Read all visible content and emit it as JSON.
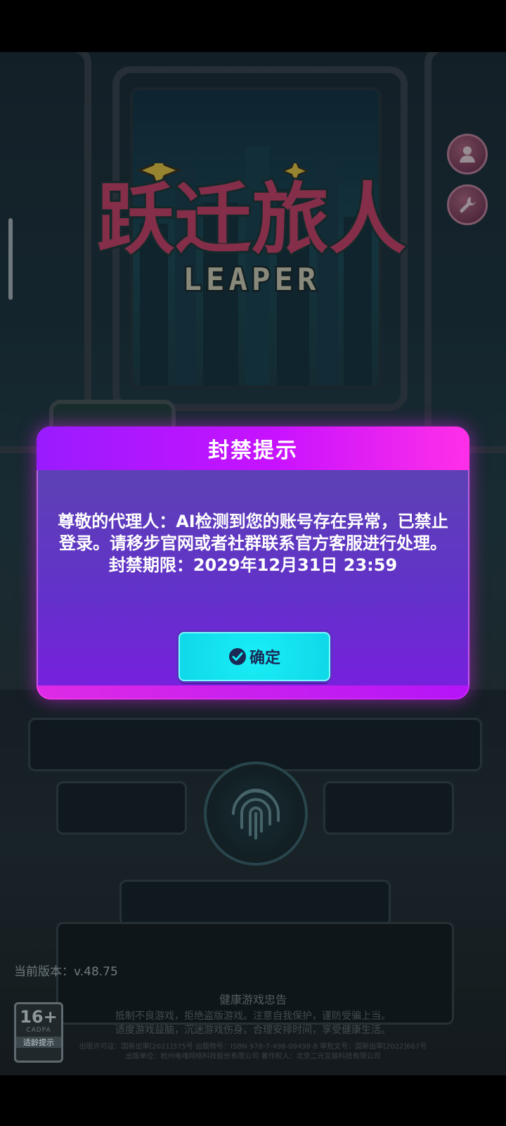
{
  "game": {
    "logo_text": "跃迁旅人",
    "logo_subtitle": "LEAPER"
  },
  "side_buttons": [
    {
      "icon": "user-icon"
    },
    {
      "icon": "wrench-icon"
    }
  ],
  "dialog": {
    "title": "封禁提示",
    "message": "尊敬的代理人：AI检测到您的账号存在异常，已禁止登录。请移步官网或者社群联系官方客服进行处理。",
    "deadline_label": "封禁期限：",
    "deadline_value": "2029年12月31日 23:59",
    "confirm_label": "确定",
    "colors": {
      "header": "#c812ff",
      "body": "#6232c9",
      "button": "#19eef6"
    }
  },
  "footer": {
    "version": "当前版本：v.48.75",
    "age_rating": "16+",
    "age_brand": "CADPA",
    "age_label": "适龄提示",
    "health_title": "健康游戏忠告",
    "health_line_1": "抵制不良游戏，拒绝盗版游戏。注意自我保护，谨防受骗上当。",
    "health_line_2": "适度游戏益脑，沉迷游戏伤身。合理安排时间，享受健康生活。",
    "license_line": "出版许可证：国新出审[2021]375号 出版物号：ISBN 978-7-498-09498-8 审批文号：国新出审[2022]667号",
    "publisher_line": "出版单位：杭州电魂网络科技股份有限公司 著作权人：北京二元互娱科技有限公司"
  }
}
